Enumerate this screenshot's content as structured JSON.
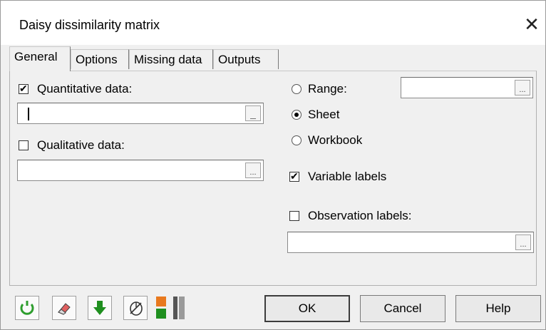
{
  "window": {
    "title": "Daisy dissimilarity matrix",
    "close_glyph": "✕"
  },
  "tabs": [
    {
      "label": "General",
      "active": true
    },
    {
      "label": "Options",
      "active": false
    },
    {
      "label": "Missing data",
      "active": false
    },
    {
      "label": "Outputs",
      "active": false
    }
  ],
  "general": {
    "quantitative": {
      "label": "Quantitative data:",
      "checked": true,
      "value": ""
    },
    "qualitative": {
      "label": "Qualitative data:",
      "checked": false,
      "value": ""
    },
    "range": {
      "label": "Range:",
      "selected": false,
      "value": ""
    },
    "sheet": {
      "label": "Sheet",
      "selected": true
    },
    "workbook": {
      "label": "Workbook",
      "selected": false
    },
    "variable_labels": {
      "label": "Variable labels",
      "checked": true
    },
    "observation_labels": {
      "label": "Observation labels:",
      "checked": false,
      "value": ""
    },
    "ellipsis_glyph": "...",
    "dash_glyph": "_"
  },
  "footer": {
    "tools": [
      {
        "icon": "reset-icon",
        "color": "#2e9e2e"
      },
      {
        "icon": "eraser-icon",
        "color": "#d94a4a"
      },
      {
        "icon": "down-arrow-icon",
        "color": "#1f8f1f"
      },
      {
        "icon": "mouse-icon",
        "color": "#333333"
      },
      {
        "icon": "color-scale-icon",
        "color": "#e8791e"
      }
    ],
    "ok_label": "OK",
    "cancel_label": "Cancel",
    "help_label": "Help"
  }
}
